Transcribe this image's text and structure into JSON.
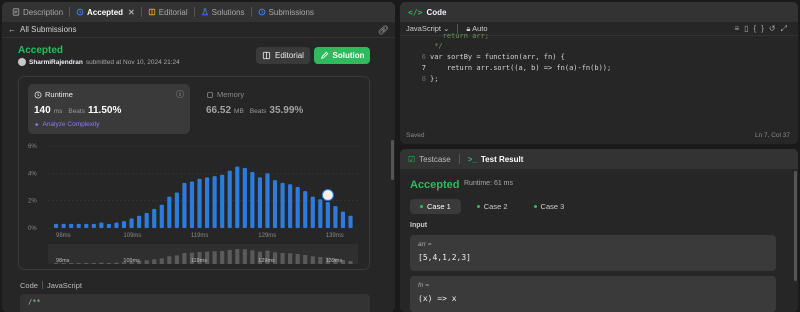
{
  "tabs": {
    "description": "Description",
    "accepted": "Accepted",
    "editorial": "Editorial",
    "solutions": "Solutions",
    "submissions": "Submissions"
  },
  "subbar": {
    "back_label": "All Submissions"
  },
  "result": {
    "status": "Accepted",
    "user": "SharmiRajendran",
    "submitted_text": "submitted at Nov 10, 2024 21:24",
    "editorial_btn": "Editorial",
    "solution_btn": "Solution"
  },
  "runtime": {
    "title": "Runtime",
    "value": "140",
    "unit": "ms",
    "beats_label": "Beats",
    "beats": "11.50%",
    "analyze": "Analyze Complexity"
  },
  "memory": {
    "title": "Memory",
    "value": "66.52",
    "unit": "MB",
    "beats_label": "Beats",
    "beats": "35.99%"
  },
  "chart_data": {
    "type": "bar",
    "y_ticks": [
      "6%",
      "4%",
      "2%",
      "0%"
    ],
    "ylim": [
      0,
      6
    ],
    "x_ticks": [
      "98ms",
      "109ms",
      "119ms",
      "129ms",
      "139ms"
    ],
    "values": [
      0.3,
      0.3,
      0.3,
      0.3,
      0.3,
      0.3,
      0.4,
      0.3,
      0.4,
      0.5,
      0.7,
      0.9,
      1.1,
      1.4,
      1.7,
      2.3,
      2.6,
      3.3,
      3.4,
      3.6,
      3.7,
      3.8,
      3.9,
      4.2,
      4.5,
      4.4,
      4.1,
      3.7,
      4.0,
      3.5,
      3.3,
      3.2,
      3.0,
      2.7,
      2.3,
      2.1,
      1.9,
      1.6,
      1.2,
      0.9
    ],
    "highlight_index": 36,
    "bar_color": "#2b7cde",
    "mini_x_ticks": [
      "98ms",
      "109ms",
      "119ms",
      "129ms",
      "139ms"
    ]
  },
  "code_block": {
    "label": "Code",
    "language": "JavaScript",
    "snippet": "/**"
  },
  "code_panel": {
    "title": "Code",
    "language": "JavaScript",
    "mode": "Auto",
    "lines": [
      {
        "n": "",
        "text": "   return arr;"
      },
      {
        "n": "",
        "text": " */"
      },
      {
        "n": "6",
        "text": "var sortBy = function(arr, fn) {"
      },
      {
        "n": "7",
        "text": "    return arr.sort((a, b) => fn(a)-fn(b));"
      },
      {
        "n": "8",
        "text": "};"
      }
    ],
    "status": "Saved",
    "position": "Ln 7, Col 37"
  },
  "test_panel": {
    "testcase_tab": "Testcase",
    "result_tab": "Test Result",
    "status": "Accepted",
    "runtime": "Runtime: 61 ms",
    "cases": [
      "Case 1",
      "Case 2",
      "Case 3"
    ],
    "input_label": "Input",
    "vars": [
      {
        "name": "arr =",
        "value": "[5,4,1,2,3]"
      },
      {
        "name": "fn =",
        "value": "(x) => x"
      }
    ]
  },
  "colors": {
    "accent_green": "#2cbb5d",
    "bar_blue": "#2b7cde",
    "analyze_purple": "#8e7cf4"
  }
}
